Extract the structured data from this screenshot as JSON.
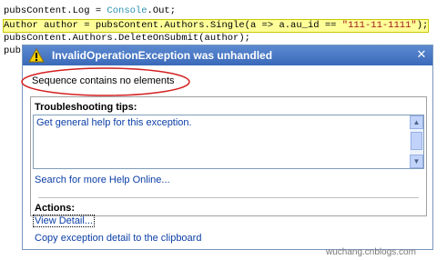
{
  "code": {
    "line1": [
      "pubsContent.Log = ",
      "Console",
      ".Out;"
    ],
    "line2": [
      "Author author = pubsContent.Authors.Single(a => a.au_id == ",
      "\"111-11-1111\"",
      ");"
    ],
    "line3": "pubsContent.Authors.DeleteOnSubmit(author);",
    "line4": "pub"
  },
  "dialog": {
    "icon": "warning-icon",
    "title": "InvalidOperationException was unhandled",
    "close_label": "✕",
    "message": "Sequence contains no elements",
    "troubleshooting_header": "Troubleshooting tips:",
    "tip": "Get general help for this exception.",
    "search_link": "Search for more Help Online...",
    "actions_header": "Actions:",
    "view_detail": "View Detail...",
    "copy_detail": "Copy exception detail to the clipboard"
  },
  "colors": {
    "title_bar": "#3a69b9",
    "link": "#0b3ea6",
    "annotation_ellipse": "#d42020",
    "highlight": "#ffff99"
  },
  "watermark": "wuchang.cnblogs.com"
}
